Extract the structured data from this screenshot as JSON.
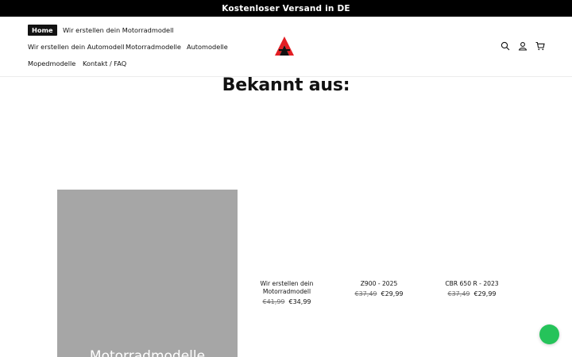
{
  "announcement": {
    "text": "Kostenloser Versand in DE"
  },
  "nav": {
    "items": [
      {
        "label": "Home"
      },
      {
        "label": "Wir erstellen dein Motorradmodell"
      },
      {
        "label": "Wir erstellen dein Automodell"
      },
      {
        "label": "Motorradmodelle"
      },
      {
        "label": "Automodelle"
      },
      {
        "label": "Mopedmodelle"
      },
      {
        "label": "Kontakt / FAQ"
      }
    ]
  },
  "header_icons": [
    "search-icon",
    "account-icon",
    "cart-icon"
  ],
  "colors": {
    "brand_red": "#e31e24",
    "dark": "#121212",
    "chat_green": "#25c35a",
    "card_grey": "#a6a6a6"
  },
  "section": {
    "heading": "Bekannt aus:"
  },
  "collection": {
    "title": "Motorradmodelle"
  },
  "products": [
    {
      "title_line1": "Wir erstellen dein",
      "title_line2": "Motorradmodell",
      "price_old": "€41,99",
      "price_new": "€34,99"
    },
    {
      "title_line1": "Z900 - 2025",
      "title_line2": "",
      "price_old": "€37,49",
      "price_new": "€29,99"
    },
    {
      "title_line1": "CBR 650 R - 2023",
      "title_line2": "",
      "price_old": "€37,49",
      "price_new": "€29,99"
    }
  ]
}
